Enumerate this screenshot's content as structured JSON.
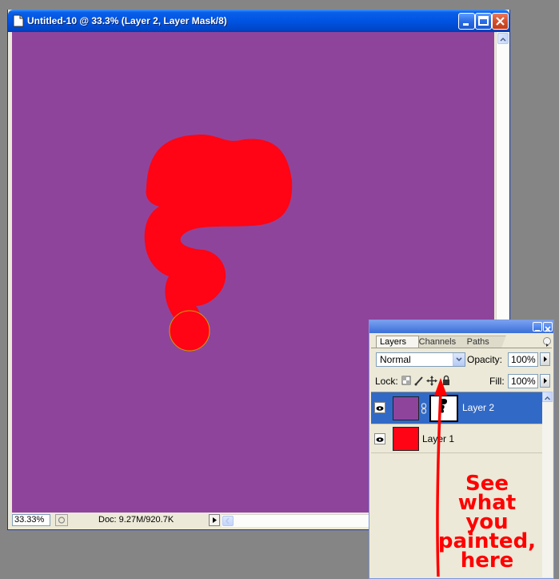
{
  "document_window": {
    "title": "Untitled-10 @ 33.3% (Layer 2, Layer Mask/8)",
    "canvas_color": "#8f449c",
    "paint_color": "#ff0415",
    "status": {
      "zoom": "33.33%",
      "doc_info": "Doc: 9.27M/920.7K"
    }
  },
  "layers_panel": {
    "tabs": [
      "Layers",
      "Channels",
      "Paths"
    ],
    "active_tab": "Layers",
    "blend_mode": "Normal",
    "opacity_label": "Opacity:",
    "opacity": "100%",
    "lock_label": "Lock:",
    "fill_label": "Fill:",
    "fill": "100%",
    "layers": [
      {
        "name": "Layer 2",
        "selected": true,
        "thumb_color": "#8f449c",
        "has_mask": true
      },
      {
        "name": "Layer 1",
        "selected": false,
        "thumb_color": "#ff0415",
        "has_mask": false
      }
    ]
  },
  "annotation": {
    "lines": [
      "See",
      "what",
      "you",
      "painted,",
      "here"
    ],
    "color": "#ff0000"
  }
}
